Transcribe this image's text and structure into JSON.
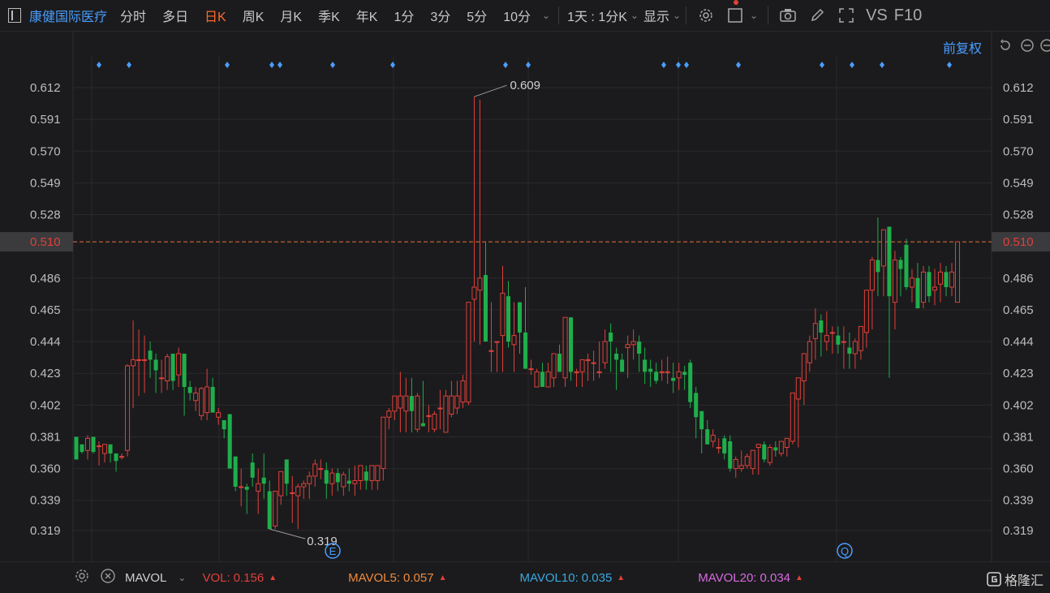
{
  "toolbar": {
    "stock_name": "康健国际医疗",
    "tabs": [
      "分时",
      "多日",
      "日K",
      "周K",
      "月K",
      "季K",
      "年K",
      "1分",
      "3分",
      "5分",
      "10分"
    ],
    "active_tab": "日K",
    "interval_select": "1天 : 1分K",
    "display_label": "显示",
    "right_labels": [
      "VS",
      "F10"
    ]
  },
  "adjust_label": "前复权",
  "footer": {
    "indicator": "MAVOL",
    "vol_label": "VOL:",
    "vol_value": "0.156",
    "mavol5_label": "MAVOL5:",
    "mavol5_value": "0.057",
    "mavol10_label": "MAVOL10:",
    "mavol10_value": "0.035",
    "mavol20_label": "MAVOL20:",
    "mavol20_value": "0.034",
    "brand": "格隆汇"
  },
  "colors": {
    "up": "#e0403a",
    "down": "#1fae4b",
    "accent": "#ff6a2a",
    "mavol5": "#f08a3c",
    "mavol10": "#3aa8e0",
    "mavol20": "#d96ae0",
    "marker": "#4a9eff"
  },
  "chart_data": {
    "type": "candlestick",
    "y_ticks": [
      "0.612",
      "0.591",
      "0.570",
      "0.549",
      "0.528",
      "0.510",
      "0.486",
      "0.465",
      "0.444",
      "0.423",
      "0.402",
      "0.381",
      "0.360",
      "0.339",
      "0.319"
    ],
    "last_price": "0.510",
    "max_label": "0.609",
    "min_label": "0.319",
    "event_markers": [
      "E",
      "Q"
    ],
    "candles": [
      [
        0.381,
        0.381,
        0.366,
        0.366
      ],
      [
        0.376,
        0.376,
        0.37,
        0.371
      ],
      [
        0.372,
        0.382,
        0.366,
        0.38
      ],
      [
        0.381,
        0.381,
        0.37,
        0.371
      ],
      [
        0.375,
        0.378,
        0.362,
        0.375
      ],
      [
        0.37,
        0.376,
        0.364,
        0.376
      ],
      [
        0.376,
        0.376,
        0.364,
        0.37
      ],
      [
        0.37,
        0.37,
        0.358,
        0.365
      ],
      [
        0.368,
        0.37,
        0.366,
        0.368
      ],
      [
        0.372,
        0.429,
        0.368,
        0.428
      ],
      [
        0.428,
        0.458,
        0.4,
        0.432
      ],
      [
        0.432,
        0.452,
        0.408,
        0.432
      ],
      [
        0.432,
        0.448,
        0.41,
        0.432
      ],
      [
        0.438,
        0.444,
        0.42,
        0.432
      ],
      [
        0.432,
        0.436,
        0.41,
        0.425
      ],
      [
        0.42,
        0.432,
        0.41,
        0.42
      ],
      [
        0.418,
        0.436,
        0.412,
        0.434
      ],
      [
        0.436,
        0.436,
        0.412,
        0.418
      ],
      [
        0.422,
        0.44,
        0.414,
        0.436
      ],
      [
        0.436,
        0.436,
        0.395,
        0.414
      ],
      [
        0.414,
        0.418,
        0.405,
        0.41
      ],
      [
        0.405,
        0.414,
        0.398,
        0.41
      ],
      [
        0.395,
        0.414,
        0.392,
        0.413
      ],
      [
        0.397,
        0.426,
        0.392,
        0.414
      ],
      [
        0.414,
        0.42,
        0.398,
        0.397
      ],
      [
        0.394,
        0.4,
        0.389,
        0.397
      ],
      [
        0.392,
        0.392,
        0.38,
        0.386
      ],
      [
        0.396,
        0.396,
        0.36,
        0.36
      ],
      [
        0.368,
        0.368,
        0.345,
        0.348
      ],
      [
        0.348,
        0.36,
        0.335,
        0.348
      ],
      [
        0.348,
        0.35,
        0.33,
        0.346
      ],
      [
        0.364,
        0.37,
        0.348,
        0.354
      ],
      [
        0.345,
        0.36,
        0.33,
        0.35
      ],
      [
        0.354,
        0.37,
        0.34,
        0.35
      ],
      [
        0.345,
        0.352,
        0.32,
        0.32
      ],
      [
        0.322,
        0.345,
        0.32,
        0.345
      ],
      [
        0.342,
        0.358,
        0.336,
        0.358
      ],
      [
        0.366,
        0.366,
        0.342,
        0.35
      ],
      [
        0.344,
        0.355,
        0.324,
        0.344
      ],
      [
        0.342,
        0.35,
        0.32,
        0.348
      ],
      [
        0.348,
        0.352,
        0.34,
        0.35
      ],
      [
        0.35,
        0.358,
        0.34,
        0.355
      ],
      [
        0.355,
        0.366,
        0.348,
        0.363
      ],
      [
        0.36,
        0.366,
        0.353,
        0.36
      ],
      [
        0.359,
        0.364,
        0.34,
        0.35
      ],
      [
        0.35,
        0.36,
        0.342,
        0.357
      ],
      [
        0.357,
        0.36,
        0.345,
        0.351
      ],
      [
        0.348,
        0.358,
        0.342,
        0.356
      ],
      [
        0.352,
        0.36,
        0.345,
        0.35
      ],
      [
        0.35,
        0.362,
        0.342,
        0.352
      ],
      [
        0.352,
        0.362,
        0.346,
        0.362
      ],
      [
        0.358,
        0.362,
        0.346,
        0.352
      ],
      [
        0.352,
        0.362,
        0.346,
        0.362
      ],
      [
        0.352,
        0.362,
        0.346,
        0.362
      ],
      [
        0.36,
        0.394,
        0.352,
        0.394
      ],
      [
        0.394,
        0.4,
        0.386,
        0.398
      ],
      [
        0.398,
        0.408,
        0.392,
        0.408
      ],
      [
        0.4,
        0.424,
        0.384,
        0.408
      ],
      [
        0.398,
        0.42,
        0.384,
        0.408
      ],
      [
        0.408,
        0.42,
        0.384,
        0.398
      ],
      [
        0.386,
        0.41,
        0.384,
        0.408
      ],
      [
        0.39,
        0.418,
        0.388,
        0.388
      ],
      [
        0.395,
        0.402,
        0.384,
        0.395
      ],
      [
        0.386,
        0.398,
        0.384,
        0.396
      ],
      [
        0.4,
        0.412,
        0.386,
        0.4
      ],
      [
        0.384,
        0.412,
        0.384,
        0.408
      ],
      [
        0.396,
        0.418,
        0.394,
        0.408
      ],
      [
        0.4,
        0.418,
        0.396,
        0.408
      ],
      [
        0.404,
        0.422,
        0.4,
        0.418
      ],
      [
        0.404,
        0.47,
        0.402,
        0.47
      ],
      [
        0.472,
        0.606,
        0.444,
        0.48
      ],
      [
        0.478,
        0.604,
        0.442,
        0.486
      ],
      [
        0.488,
        0.51,
        0.444,
        0.444
      ],
      [
        0.438,
        0.47,
        0.424,
        0.438
      ],
      [
        0.444,
        0.444,
        0.424,
        0.444
      ],
      [
        0.448,
        0.494,
        0.424,
        0.476
      ],
      [
        0.474,
        0.484,
        0.44,
        0.444
      ],
      [
        0.442,
        0.47,
        0.424,
        0.448
      ],
      [
        0.47,
        0.47,
        0.436,
        0.45
      ],
      [
        0.45,
        0.48,
        0.43,
        0.426
      ],
      [
        0.426,
        0.432,
        0.422,
        0.426
      ],
      [
        0.414,
        0.426,
        0.414,
        0.424
      ],
      [
        0.424,
        0.43,
        0.424,
        0.414
      ],
      [
        0.414,
        0.43,
        0.414,
        0.424
      ],
      [
        0.42,
        0.432,
        0.414,
        0.436
      ],
      [
        0.436,
        0.442,
        0.436,
        0.424
      ],
      [
        0.42,
        0.44,
        0.414,
        0.46
      ],
      [
        0.46,
        0.46,
        0.418,
        0.424
      ],
      [
        0.424,
        0.426,
        0.414,
        0.424
      ],
      [
        0.424,
        0.424,
        0.414,
        0.432
      ],
      [
        0.432,
        0.436,
        0.418,
        0.432
      ],
      [
        0.43,
        0.438,
        0.418,
        0.43
      ],
      [
        0.424,
        0.444,
        0.42,
        0.424
      ],
      [
        0.43,
        0.452,
        0.426,
        0.444
      ],
      [
        0.45,
        0.456,
        0.424,
        0.444
      ],
      [
        0.436,
        0.44,
        0.412,
        0.432
      ],
      [
        0.432,
        0.436,
        0.424,
        0.424
      ],
      [
        0.44,
        0.448,
        0.42,
        0.442
      ],
      [
        0.442,
        0.452,
        0.432,
        0.444
      ],
      [
        0.444,
        0.448,
        0.424,
        0.436
      ],
      [
        0.432,
        0.44,
        0.416,
        0.424
      ],
      [
        0.426,
        0.432,
        0.414,
        0.424
      ],
      [
        0.424,
        0.43,
        0.416,
        0.418
      ],
      [
        0.424,
        0.432,
        0.418,
        0.424
      ],
      [
        0.424,
        0.434,
        0.416,
        0.424
      ],
      [
        0.42,
        0.43,
        0.41,
        0.418
      ],
      [
        0.42,
        0.43,
        0.412,
        0.424
      ],
      [
        0.424,
        0.428,
        0.412,
        0.422
      ],
      [
        0.43,
        0.432,
        0.4,
        0.404
      ],
      [
        0.41,
        0.414,
        0.38,
        0.394
      ],
      [
        0.398,
        0.398,
        0.37,
        0.386
      ],
      [
        0.386,
        0.392,
        0.376,
        0.376
      ],
      [
        0.378,
        0.386,
        0.374,
        0.382
      ],
      [
        0.374,
        0.38,
        0.37,
        0.374
      ],
      [
        0.38,
        0.382,
        0.366,
        0.37
      ],
      [
        0.378,
        0.382,
        0.358,
        0.36
      ],
      [
        0.36,
        0.368,
        0.354,
        0.366
      ],
      [
        0.36,
        0.372,
        0.358,
        0.362
      ],
      [
        0.362,
        0.37,
        0.36,
        0.368
      ],
      [
        0.36,
        0.372,
        0.356,
        0.372
      ],
      [
        0.374,
        0.374,
        0.356,
        0.376
      ],
      [
        0.376,
        0.378,
        0.364,
        0.366
      ],
      [
        0.364,
        0.376,
        0.362,
        0.374
      ],
      [
        0.374,
        0.378,
        0.368,
        0.372
      ],
      [
        0.37,
        0.378,
        0.368,
        0.378
      ],
      [
        0.374,
        0.38,
        0.368,
        0.38
      ],
      [
        0.378,
        0.41,
        0.376,
        0.41
      ],
      [
        0.406,
        0.418,
        0.374,
        0.42
      ],
      [
        0.418,
        0.436,
        0.402,
        0.436
      ],
      [
        0.43,
        0.448,
        0.424,
        0.444
      ],
      [
        0.446,
        0.466,
        0.432,
        0.456
      ],
      [
        0.458,
        0.462,
        0.434,
        0.45
      ],
      [
        0.444,
        0.464,
        0.438,
        0.448
      ],
      [
        0.45,
        0.454,
        0.436,
        0.45
      ],
      [
        0.448,
        0.454,
        0.436,
        0.442
      ],
      [
        0.444,
        0.454,
        0.426,
        0.444
      ],
      [
        0.44,
        0.45,
        0.426,
        0.436
      ],
      [
        0.436,
        0.446,
        0.426,
        0.444
      ],
      [
        0.438,
        0.45,
        0.432,
        0.454
      ],
      [
        0.45,
        0.478,
        0.44,
        0.478
      ],
      [
        0.478,
        0.5,
        0.452,
        0.498
      ],
      [
        0.498,
        0.526,
        0.474,
        0.49
      ],
      [
        0.494,
        0.516,
        0.474,
        0.518
      ],
      [
        0.52,
        0.52,
        0.42,
        0.474
      ],
      [
        0.47,
        0.504,
        0.452,
        0.498
      ],
      [
        0.498,
        0.5,
        0.474,
        0.492
      ],
      [
        0.508,
        0.512,
        0.478,
        0.48
      ],
      [
        0.48,
        0.492,
        0.47,
        0.486
      ],
      [
        0.486,
        0.496,
        0.466,
        0.466
      ],
      [
        0.47,
        0.494,
        0.466,
        0.49
      ],
      [
        0.49,
        0.494,
        0.47,
        0.474
      ],
      [
        0.478,
        0.492,
        0.468,
        0.48
      ],
      [
        0.482,
        0.496,
        0.47,
        0.49
      ],
      [
        0.49,
        0.494,
        0.474,
        0.48
      ],
      [
        0.48,
        0.496,
        0.474,
        0.49
      ],
      [
        0.47,
        0.51,
        0.47,
        0.51
      ]
    ]
  }
}
